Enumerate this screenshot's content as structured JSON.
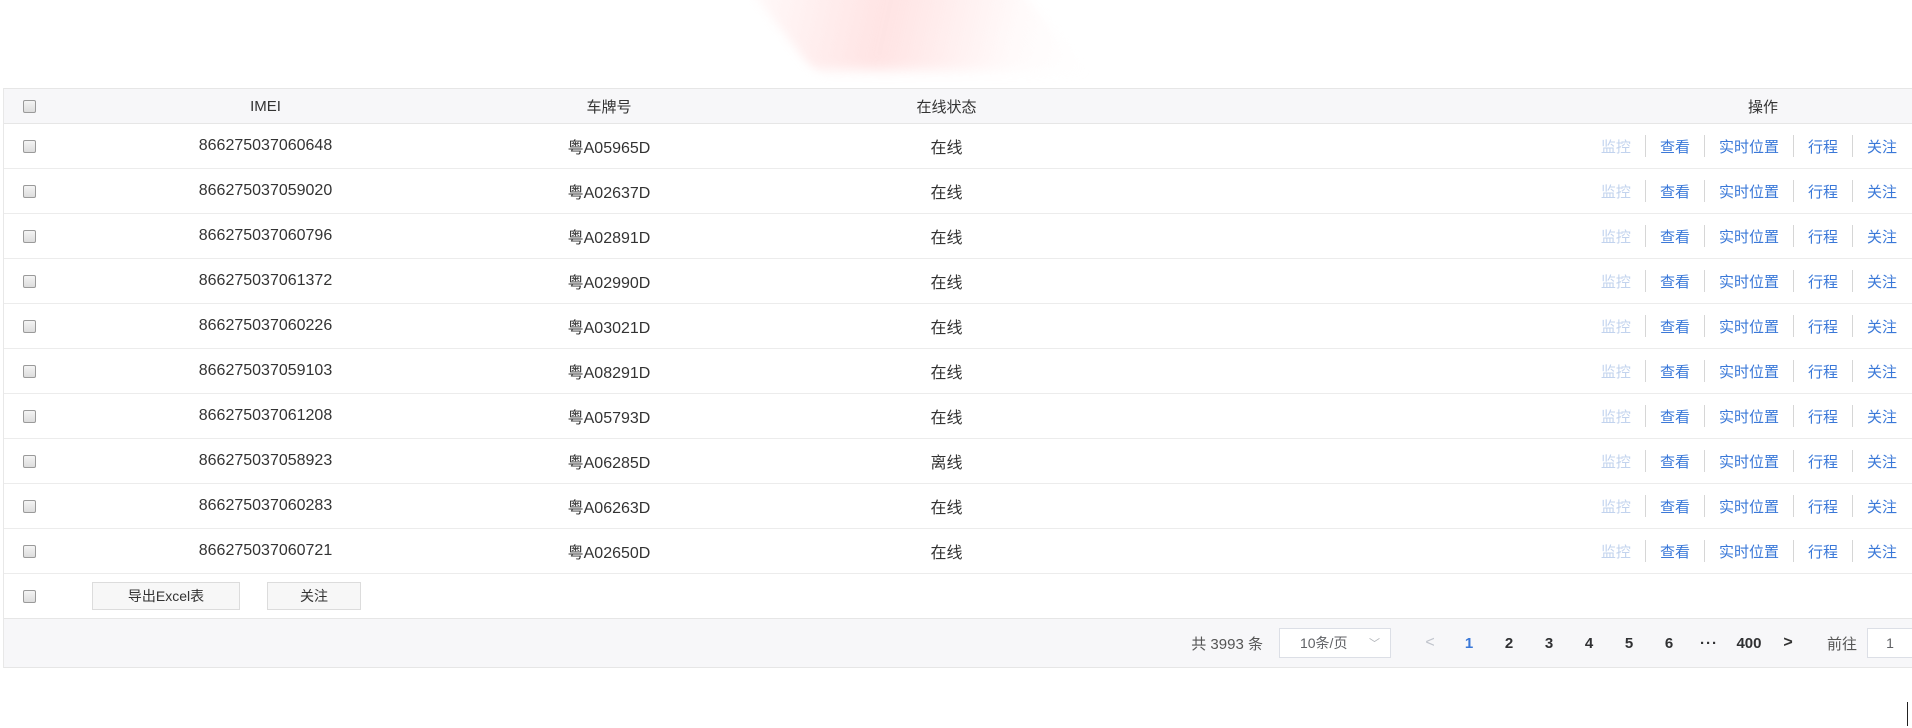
{
  "table": {
    "columns": {
      "imei": "IMEI",
      "plate": "车牌号",
      "status": "在线状态",
      "ops": "操作"
    },
    "ops_labels": {
      "monitor": "监控",
      "view": "查看",
      "realtime": "实时位置",
      "trip": "行程",
      "follow": "关注"
    },
    "rows": [
      {
        "imei": "866275037060648",
        "plate": "粤A05965D",
        "status": "在线"
      },
      {
        "imei": "866275037059020",
        "plate": "粤A02637D",
        "status": "在线"
      },
      {
        "imei": "866275037060796",
        "plate": "粤A02891D",
        "status": "在线"
      },
      {
        "imei": "866275037061372",
        "plate": "粤A02990D",
        "status": "在线"
      },
      {
        "imei": "866275037060226",
        "plate": "粤A03021D",
        "status": "在线"
      },
      {
        "imei": "866275037059103",
        "plate": "粤A08291D",
        "status": "在线"
      },
      {
        "imei": "866275037061208",
        "plate": "粤A05793D",
        "status": "在线"
      },
      {
        "imei": "866275037058923",
        "plate": "粤A06285D",
        "status": "离线"
      },
      {
        "imei": "866275037060283",
        "plate": "粤A06263D",
        "status": "在线"
      },
      {
        "imei": "866275037060721",
        "plate": "粤A02650D",
        "status": "在线"
      }
    ]
  },
  "footer": {
    "export_label": "导出Excel表",
    "follow_label": "关注"
  },
  "pager": {
    "total": "共 3993 条",
    "page_size": "10条/页",
    "pages": [
      "1",
      "2",
      "3",
      "4",
      "5",
      "6",
      "···",
      "400"
    ],
    "active_page": "1",
    "goto_label": "前往",
    "goto_value": "1"
  },
  "colors": {
    "link": "#3a78d8",
    "link_disabled": "#c2d3ee",
    "header_bg": "#f7f7f9"
  }
}
